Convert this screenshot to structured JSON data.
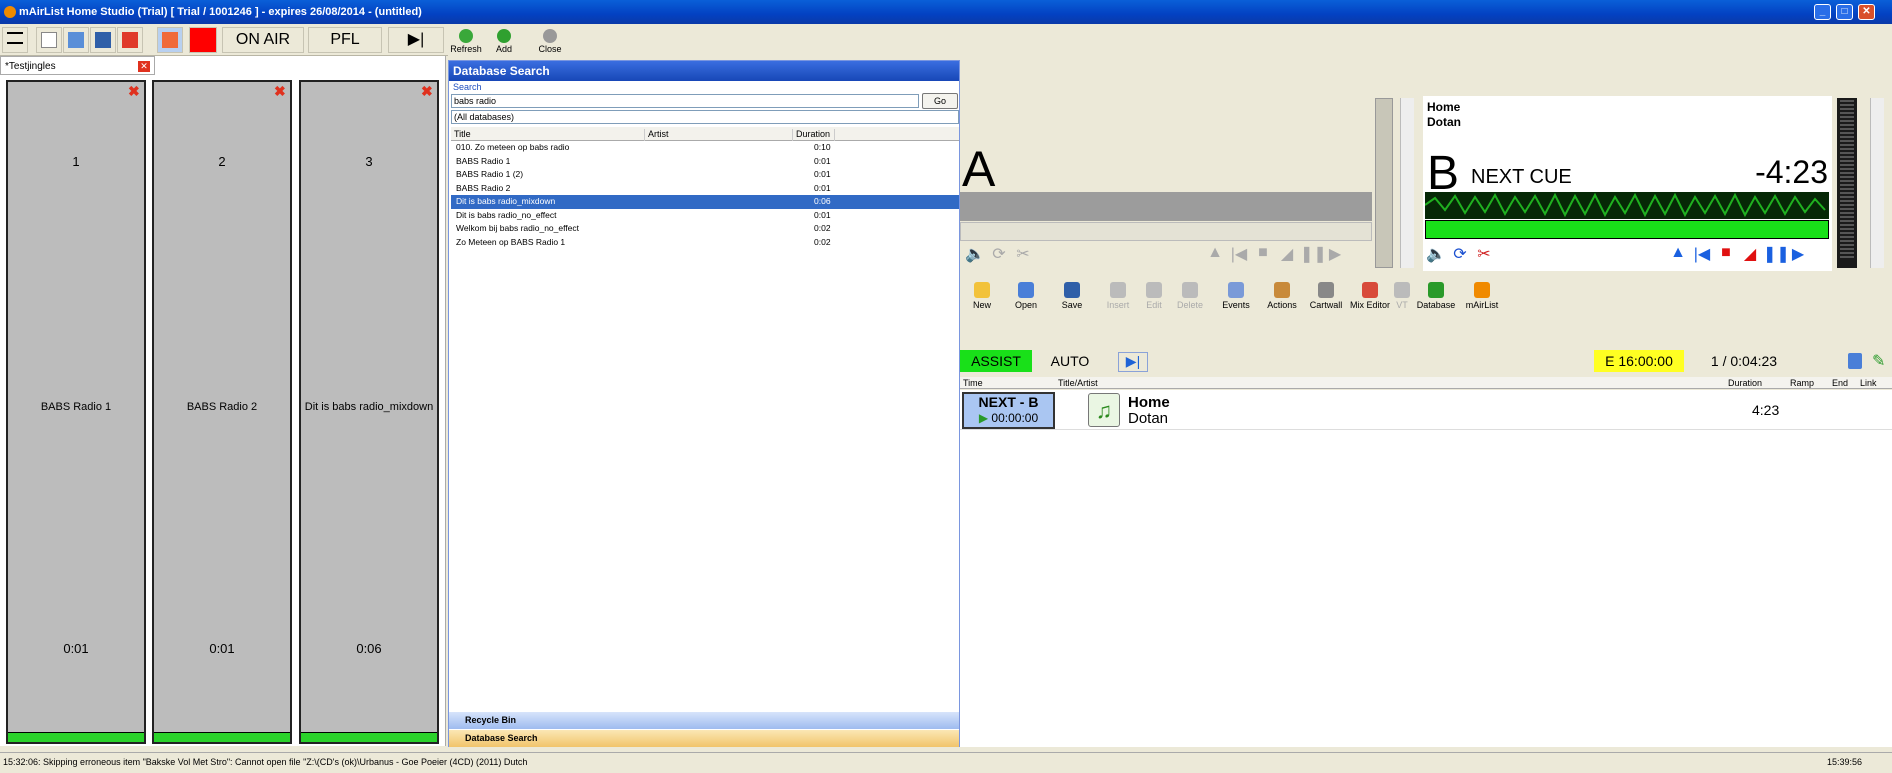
{
  "window": {
    "title": "mAirList Home Studio (Trial) [ Trial / 1001246 ] - expires 26/08/2014 - (untitled)"
  },
  "toolbar": {
    "on_air": "ON AIR",
    "pfl": "PFL",
    "on_air_color": "#ff0000"
  },
  "db_toolbar": {
    "refresh": "Refresh",
    "add": "Add",
    "close": "Close"
  },
  "cartwall": {
    "tab": "*Testjingles",
    "carts": [
      {
        "number": "1",
        "title": "BABS Radio 1",
        "duration": "0:01"
      },
      {
        "number": "2",
        "title": "BABS Radio 2",
        "duration": "0:01"
      },
      {
        "number": "3",
        "title": "Dit is babs radio_mixdown",
        "duration": "0:06"
      }
    ]
  },
  "dbsearch": {
    "title": "Database Search",
    "search_label": "Search",
    "query": "babs radio",
    "go": "Go",
    "scope": "(All databases)",
    "columns": [
      "Title",
      "Artist",
      "Duration"
    ],
    "rows": [
      {
        "title": "010. Zo meteen op babs radio",
        "artist": "",
        "duration": "0:10"
      },
      {
        "title": "BABS Radio 1",
        "artist": "",
        "duration": "0:01"
      },
      {
        "title": "BABS Radio 1 (2)",
        "artist": "",
        "duration": "0:01"
      },
      {
        "title": "BABS Radio 2",
        "artist": "",
        "duration": "0:01"
      },
      {
        "title": "Dit is babs radio_mixdown",
        "artist": "",
        "duration": "0:06"
      },
      {
        "title": "Dit is babs radio_no_effect",
        "artist": "",
        "duration": "0:01"
      },
      {
        "title": "Welkom bij babs radio_no_effect",
        "artist": "",
        "duration": "0:02"
      },
      {
        "title": "Zo Meteen op BABS Radio 1",
        "artist": "",
        "duration": "0:02"
      }
    ],
    "selected_index": 4,
    "recycle_bin": "Recycle Bin",
    "db_tab": "Database Search"
  },
  "playerA": {
    "label": "A"
  },
  "playerB": {
    "title": "Home",
    "artist": "Dotan",
    "label": "B",
    "state": "NEXT CUE",
    "remaining": "-4:23"
  },
  "player_toolbar": [
    "New",
    "Open",
    "Save",
    "Insert",
    "Edit",
    "Delete",
    "Events",
    "Actions",
    "Cartwall",
    "Mix Editor",
    "VT",
    "Database",
    "mAirList"
  ],
  "mode": {
    "assist": "ASSIST",
    "auto": "AUTO",
    "end_time": "E  16:00:00",
    "count": "1 / 0:04:23"
  },
  "playlist": {
    "columns": [
      "Time",
      "Title/Artist",
      "Duration",
      "Ramp",
      "End",
      "Link"
    ],
    "items": [
      {
        "status": "NEXT - B",
        "time": "00:00:00",
        "title": "Home",
        "artist": "Dotan",
        "duration": "4:23"
      }
    ]
  },
  "status": {
    "message": "15:32:06: Skipping erroneous item \"Bakske Vol Met Stro\": Cannot open file \"Z:\\(CD's (ok)\\Urbanus - Goe Poeier (4CD) (2011) Dutch",
    "clock": "15:39:56"
  }
}
